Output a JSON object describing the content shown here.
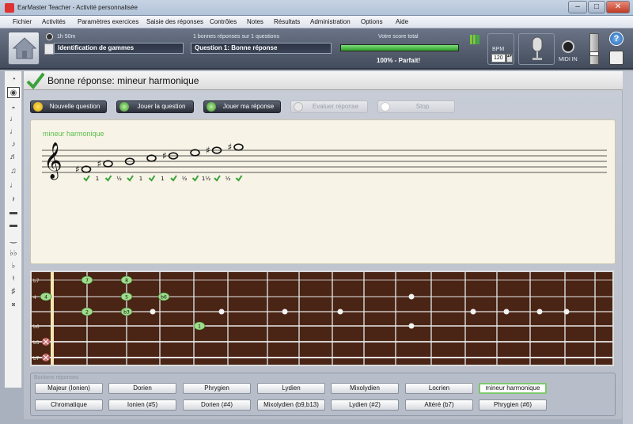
{
  "window": {
    "title": "EarMaster Teacher - Activité personnalisée",
    "min": "–",
    "max": "□",
    "close": "✕"
  },
  "menu": [
    "Fichier",
    "Activités",
    "Paramètres exercices",
    "Saisie des réponses",
    "Contrôles",
    "Notes",
    "Résultats",
    "Administration",
    "Options",
    "Aide"
  ],
  "toolbar": {
    "time": "1h 50m",
    "exercise": "Identification de gammes",
    "progress_text": "1 bonnes réponses sur 1 questions",
    "question": "Question 1: Bonne réponse",
    "score_label": "Votre score total",
    "score_fraction": 1.0,
    "score_text": "100% - Parfait!",
    "bpm_label": "BPM",
    "bpm_value": "120",
    "midi_label": "MIDI IN",
    "help": "?"
  },
  "header": {
    "text": "Bonne réponse: mineur harmonique"
  },
  "actions": {
    "new_question": "Nouvelle question",
    "play_question": "Jouer la question",
    "play_answer": "Jouer ma réponse",
    "evaluate": "Evaluer réponse",
    "stop": "Stop"
  },
  "staff": {
    "scale_name": "mineur harmonique",
    "notes": [
      "♯",
      "♯",
      "",
      "",
      "♯",
      "",
      "♯",
      "♯"
    ],
    "intervals": [
      "1",
      "½",
      "1",
      "1",
      "½",
      "1½",
      "½"
    ]
  },
  "fretboard": {
    "string_labels": [
      "b7",
      "4",
      "",
      "b6",
      "b3",
      "b7"
    ],
    "markers": [
      {
        "label": "7",
        "string": 0,
        "fret": 1
      },
      {
        "label": "8",
        "string": 0,
        "fret": 2
      },
      {
        "label": "4",
        "string": 1,
        "fret": 0
      },
      {
        "label": "5",
        "string": 1,
        "fret": 2
      },
      {
        "label": "b6",
        "string": 1,
        "fret": 3
      },
      {
        "label": "2",
        "string": 2,
        "fret": 1
      },
      {
        "label": "b3",
        "string": 2,
        "fret": 2
      },
      {
        "label": "1",
        "string": 3,
        "fret": 4
      }
    ]
  },
  "answers": {
    "title": "Boutons réponses",
    "row1": [
      "Majeur (Ionien)",
      "Dorien",
      "Phrygien",
      "Lydien",
      "Mixolydien",
      "Locrien",
      "mineur harmonique"
    ],
    "row2": [
      "Chromatique",
      "Ionien (#5)",
      "Dorien (#4)",
      "Mixolydien (b9,b13)",
      "Lydien (#2)",
      "Altéré (b7)",
      "Phrygien (#6)"
    ],
    "selected": "mineur harmonique"
  },
  "colors": {
    "accent_green": "#3aa23a",
    "wood": "#4a2414",
    "marker": "#9fdc8c"
  }
}
